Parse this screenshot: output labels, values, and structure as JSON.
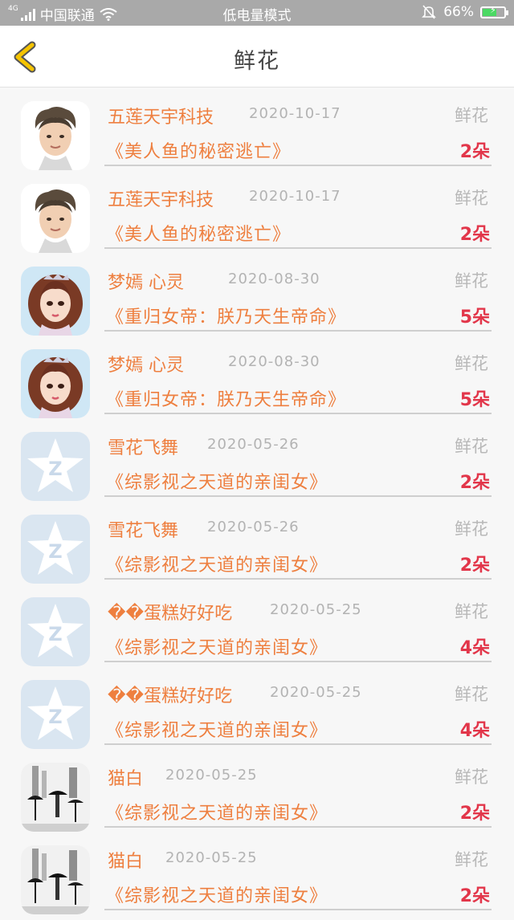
{
  "status_bar": {
    "network": "4G",
    "carrier": "中国联通",
    "mode": "低电量模式",
    "battery_percent": "66%",
    "battery_level": 0.66,
    "icons": [
      "signal-icon",
      "wifi-icon",
      "mute-bell-icon",
      "battery-icon"
    ]
  },
  "header": {
    "title": "鲜花",
    "back_icon": "chevron-left-icon"
  },
  "colors": {
    "name": "#ee7f3f",
    "book": "#ee7f3f",
    "count": "#e2364a",
    "date": "#b3b3b3",
    "gift_label": "#b8b8b8",
    "back_icon": "#f5c400"
  },
  "records": [
    {
      "avatar": "boy",
      "name": "五莲天宇科技",
      "date": "2020-10-17",
      "gift": "鲜花",
      "book": "《美人鱼的秘密逃亡》",
      "count": "2朵"
    },
    {
      "avatar": "boy",
      "name": "五莲天宇科技",
      "date": "2020-10-17",
      "gift": "鲜花",
      "book": "《美人鱼的秘密逃亡》",
      "count": "2朵"
    },
    {
      "avatar": "girl",
      "name": "梦嫣 心灵",
      "date": "2020-08-30",
      "gift": "鲜花",
      "book": "《重归女帝：朕乃天生帝命》",
      "count": "5朵"
    },
    {
      "avatar": "girl",
      "name": "梦嫣 心灵",
      "date": "2020-08-30",
      "gift": "鲜花",
      "book": "《重归女帝：朕乃天生帝命》",
      "count": "5朵"
    },
    {
      "avatar": "qq",
      "name": "雪花飞舞",
      "date": "2020-05-26",
      "gift": "鲜花",
      "book": "《综影视之天道的亲闺女》",
      "count": "2朵"
    },
    {
      "avatar": "qq",
      "name": "雪花飞舞",
      "date": "2020-05-26",
      "gift": "鲜花",
      "book": "《综影视之天道的亲闺女》",
      "count": "2朵"
    },
    {
      "avatar": "qq",
      "name": "��蛋糕好好吃",
      "date": "2020-05-25",
      "gift": "鲜花",
      "book": "《综影视之天道的亲闺女》",
      "count": "4朵"
    },
    {
      "avatar": "qq",
      "name": "��蛋糕好好吃",
      "date": "2020-05-25",
      "gift": "鲜花",
      "book": "《综影视之天道的亲闺女》",
      "count": "4朵"
    },
    {
      "avatar": "photo",
      "name": "猫白",
      "date": "2020-05-25",
      "gift": "鲜花",
      "book": "《综影视之天道的亲闺女》",
      "count": "2朵"
    },
    {
      "avatar": "photo",
      "name": "猫白",
      "date": "2020-05-25",
      "gift": "鲜花",
      "book": "《综影视之天道的亲闺女》",
      "count": "2朵"
    }
  ]
}
